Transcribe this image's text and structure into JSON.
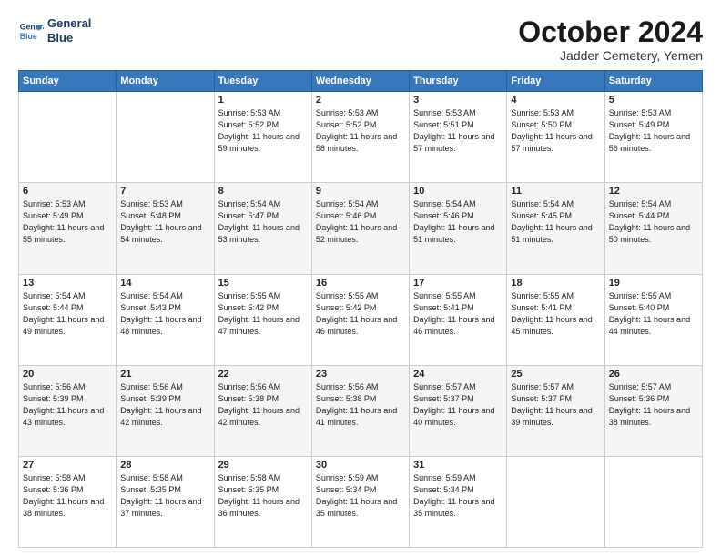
{
  "logo": {
    "line1": "General",
    "line2": "Blue"
  },
  "title": "October 2024",
  "subtitle": "Jadder Cemetery, Yemen",
  "days_header": [
    "Sunday",
    "Monday",
    "Tuesday",
    "Wednesday",
    "Thursday",
    "Friday",
    "Saturday"
  ],
  "weeks": [
    [
      {
        "num": "",
        "sunrise": "",
        "sunset": "",
        "daylight": ""
      },
      {
        "num": "",
        "sunrise": "",
        "sunset": "",
        "daylight": ""
      },
      {
        "num": "1",
        "sunrise": "Sunrise: 5:53 AM",
        "sunset": "Sunset: 5:52 PM",
        "daylight": "Daylight: 11 hours and 59 minutes."
      },
      {
        "num": "2",
        "sunrise": "Sunrise: 5:53 AM",
        "sunset": "Sunset: 5:52 PM",
        "daylight": "Daylight: 11 hours and 58 minutes."
      },
      {
        "num": "3",
        "sunrise": "Sunrise: 5:53 AM",
        "sunset": "Sunset: 5:51 PM",
        "daylight": "Daylight: 11 hours and 57 minutes."
      },
      {
        "num": "4",
        "sunrise": "Sunrise: 5:53 AM",
        "sunset": "Sunset: 5:50 PM",
        "daylight": "Daylight: 11 hours and 57 minutes."
      },
      {
        "num": "5",
        "sunrise": "Sunrise: 5:53 AM",
        "sunset": "Sunset: 5:49 PM",
        "daylight": "Daylight: 11 hours and 56 minutes."
      }
    ],
    [
      {
        "num": "6",
        "sunrise": "Sunrise: 5:53 AM",
        "sunset": "Sunset: 5:49 PM",
        "daylight": "Daylight: 11 hours and 55 minutes."
      },
      {
        "num": "7",
        "sunrise": "Sunrise: 5:53 AM",
        "sunset": "Sunset: 5:48 PM",
        "daylight": "Daylight: 11 hours and 54 minutes."
      },
      {
        "num": "8",
        "sunrise": "Sunrise: 5:54 AM",
        "sunset": "Sunset: 5:47 PM",
        "daylight": "Daylight: 11 hours and 53 minutes."
      },
      {
        "num": "9",
        "sunrise": "Sunrise: 5:54 AM",
        "sunset": "Sunset: 5:46 PM",
        "daylight": "Daylight: 11 hours and 52 minutes."
      },
      {
        "num": "10",
        "sunrise": "Sunrise: 5:54 AM",
        "sunset": "Sunset: 5:46 PM",
        "daylight": "Daylight: 11 hours and 51 minutes."
      },
      {
        "num": "11",
        "sunrise": "Sunrise: 5:54 AM",
        "sunset": "Sunset: 5:45 PM",
        "daylight": "Daylight: 11 hours and 51 minutes."
      },
      {
        "num": "12",
        "sunrise": "Sunrise: 5:54 AM",
        "sunset": "Sunset: 5:44 PM",
        "daylight": "Daylight: 11 hours and 50 minutes."
      }
    ],
    [
      {
        "num": "13",
        "sunrise": "Sunrise: 5:54 AM",
        "sunset": "Sunset: 5:44 PM",
        "daylight": "Daylight: 11 hours and 49 minutes."
      },
      {
        "num": "14",
        "sunrise": "Sunrise: 5:54 AM",
        "sunset": "Sunset: 5:43 PM",
        "daylight": "Daylight: 11 hours and 48 minutes."
      },
      {
        "num": "15",
        "sunrise": "Sunrise: 5:55 AM",
        "sunset": "Sunset: 5:42 PM",
        "daylight": "Daylight: 11 hours and 47 minutes."
      },
      {
        "num": "16",
        "sunrise": "Sunrise: 5:55 AM",
        "sunset": "Sunset: 5:42 PM",
        "daylight": "Daylight: 11 hours and 46 minutes."
      },
      {
        "num": "17",
        "sunrise": "Sunrise: 5:55 AM",
        "sunset": "Sunset: 5:41 PM",
        "daylight": "Daylight: 11 hours and 46 minutes."
      },
      {
        "num": "18",
        "sunrise": "Sunrise: 5:55 AM",
        "sunset": "Sunset: 5:41 PM",
        "daylight": "Daylight: 11 hours and 45 minutes."
      },
      {
        "num": "19",
        "sunrise": "Sunrise: 5:55 AM",
        "sunset": "Sunset: 5:40 PM",
        "daylight": "Daylight: 11 hours and 44 minutes."
      }
    ],
    [
      {
        "num": "20",
        "sunrise": "Sunrise: 5:56 AM",
        "sunset": "Sunset: 5:39 PM",
        "daylight": "Daylight: 11 hours and 43 minutes."
      },
      {
        "num": "21",
        "sunrise": "Sunrise: 5:56 AM",
        "sunset": "Sunset: 5:39 PM",
        "daylight": "Daylight: 11 hours and 42 minutes."
      },
      {
        "num": "22",
        "sunrise": "Sunrise: 5:56 AM",
        "sunset": "Sunset: 5:38 PM",
        "daylight": "Daylight: 11 hours and 42 minutes."
      },
      {
        "num": "23",
        "sunrise": "Sunrise: 5:56 AM",
        "sunset": "Sunset: 5:38 PM",
        "daylight": "Daylight: 11 hours and 41 minutes."
      },
      {
        "num": "24",
        "sunrise": "Sunrise: 5:57 AM",
        "sunset": "Sunset: 5:37 PM",
        "daylight": "Daylight: 11 hours and 40 minutes."
      },
      {
        "num": "25",
        "sunrise": "Sunrise: 5:57 AM",
        "sunset": "Sunset: 5:37 PM",
        "daylight": "Daylight: 11 hours and 39 minutes."
      },
      {
        "num": "26",
        "sunrise": "Sunrise: 5:57 AM",
        "sunset": "Sunset: 5:36 PM",
        "daylight": "Daylight: 11 hours and 38 minutes."
      }
    ],
    [
      {
        "num": "27",
        "sunrise": "Sunrise: 5:58 AM",
        "sunset": "Sunset: 5:36 PM",
        "daylight": "Daylight: 11 hours and 38 minutes."
      },
      {
        "num": "28",
        "sunrise": "Sunrise: 5:58 AM",
        "sunset": "Sunset: 5:35 PM",
        "daylight": "Daylight: 11 hours and 37 minutes."
      },
      {
        "num": "29",
        "sunrise": "Sunrise: 5:58 AM",
        "sunset": "Sunset: 5:35 PM",
        "daylight": "Daylight: 11 hours and 36 minutes."
      },
      {
        "num": "30",
        "sunrise": "Sunrise: 5:59 AM",
        "sunset": "Sunset: 5:34 PM",
        "daylight": "Daylight: 11 hours and 35 minutes."
      },
      {
        "num": "31",
        "sunrise": "Sunrise: 5:59 AM",
        "sunset": "Sunset: 5:34 PM",
        "daylight": "Daylight: 11 hours and 35 minutes."
      },
      {
        "num": "",
        "sunrise": "",
        "sunset": "",
        "daylight": ""
      },
      {
        "num": "",
        "sunrise": "",
        "sunset": "",
        "daylight": ""
      }
    ]
  ]
}
